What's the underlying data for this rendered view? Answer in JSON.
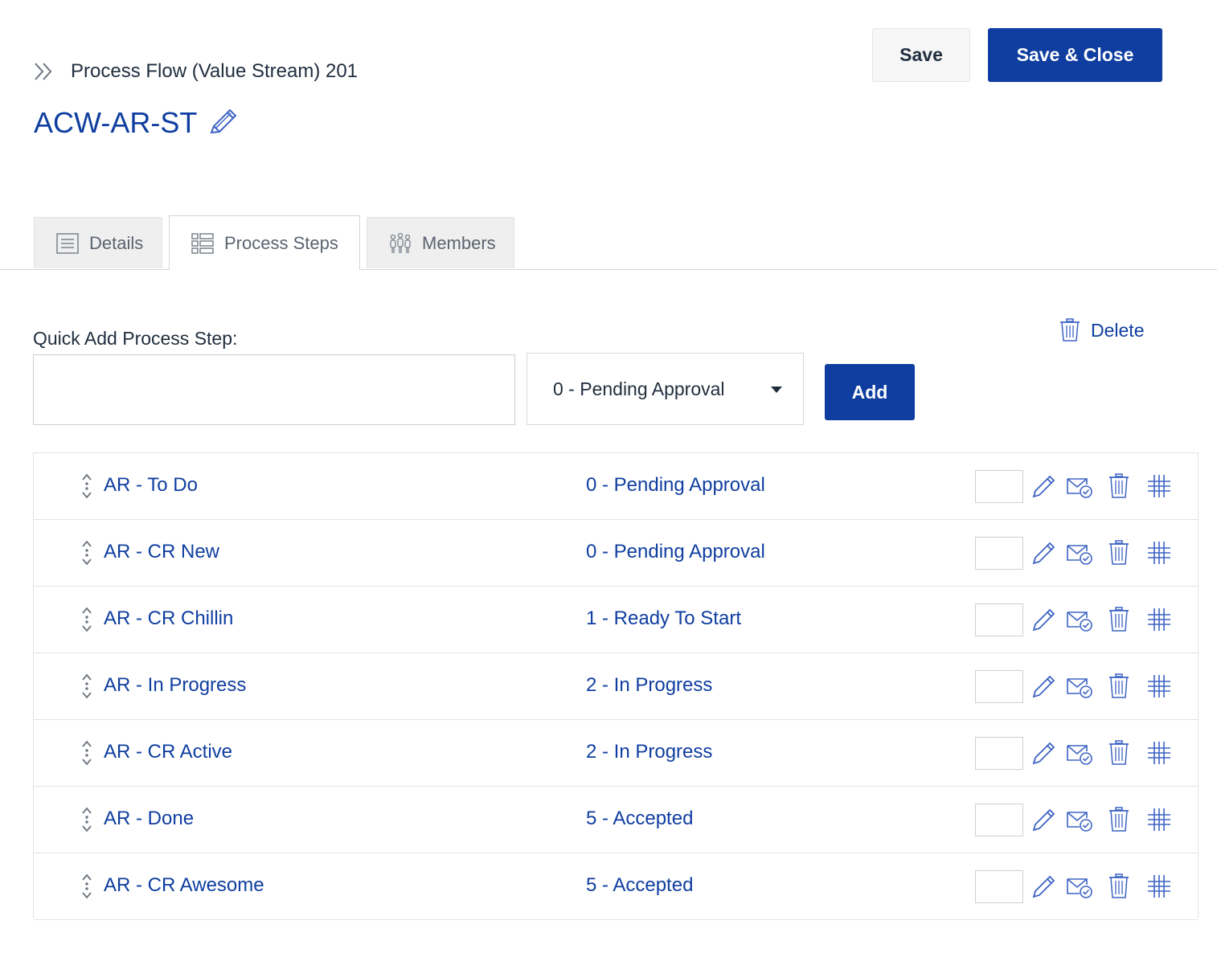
{
  "header": {
    "breadcrumb": "Process Flow (Value Stream) 201",
    "title": "ACW-AR-ST",
    "save_label": "Save",
    "save_close_label": "Save & Close"
  },
  "tabs": [
    {
      "label": "Details",
      "icon": "document-icon",
      "active": false
    },
    {
      "label": "Process Steps",
      "icon": "list-icon",
      "active": true
    },
    {
      "label": "Members",
      "icon": "people-icon",
      "active": false
    }
  ],
  "quick_add": {
    "label": "Quick Add Process Step:",
    "input_value": "",
    "select_value": "0 - Pending Approval",
    "add_label": "Add",
    "delete_label": "Delete"
  },
  "steps": [
    {
      "name": "AR - To Do",
      "state": "0 - Pending Approval"
    },
    {
      "name": "AR - CR New",
      "state": "0 - Pending Approval"
    },
    {
      "name": "AR - CR Chillin",
      "state": "1 - Ready To Start"
    },
    {
      "name": "AR - In Progress",
      "state": "2 - In Progress"
    },
    {
      "name": "AR - CR Active",
      "state": "2 - In Progress"
    },
    {
      "name": "AR - Done",
      "state": "5 - Accepted"
    },
    {
      "name": "AR - CR Awesome",
      "state": "5 - Accepted"
    }
  ],
  "colors": {
    "accent": "#0f3ea0",
    "text": "#1f2d3d",
    "border": "#e3e3e3"
  }
}
